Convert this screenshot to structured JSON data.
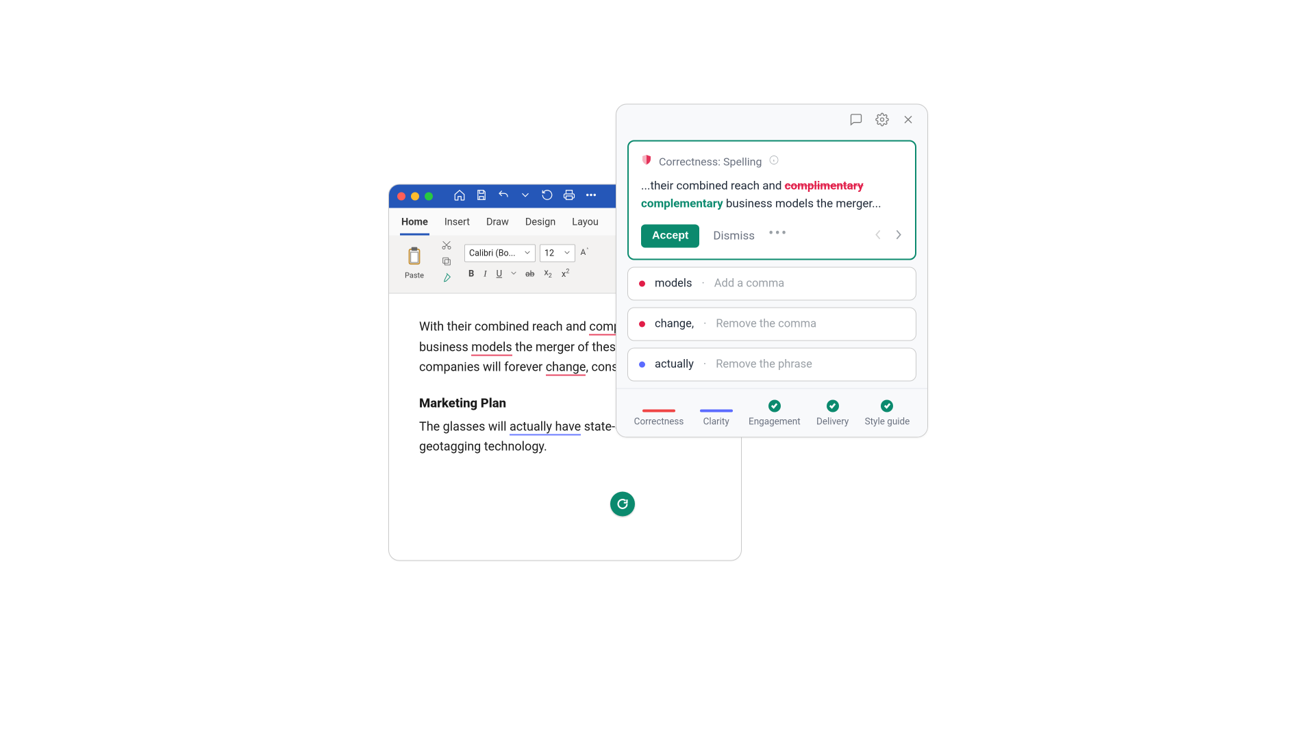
{
  "word": {
    "tabs": [
      "Home",
      "Insert",
      "Draw",
      "Design",
      "Layou"
    ],
    "activeTab": "Home",
    "paste_label": "Paste",
    "font_name": "Calibri (Bo...",
    "font_size": "12",
    "doc": {
      "p1_pre": "With their combined reach and ",
      "p1_err1": "complimentary",
      "p1_mid1": " business ",
      "p1_err2": "models",
      "p1_mid2": " the merger of these two great companies will forever ",
      "p1_err3": "change",
      "p1_post": ", consumer eyewear.",
      "h2": "Marketing Plan",
      "p2_pre": "The glasses will ",
      "p2_err": "actually have",
      "p2_post": " state-of-the-art geotagging technology."
    }
  },
  "panel": {
    "title": "Correctness: Spelling",
    "body_pre": "...their combined reach and ",
    "body_wrong": "complimentary",
    "body_fix": "complementary",
    "body_post": " business models the merger...",
    "accept": "Accept",
    "dismiss": "Dismiss",
    "items": [
      {
        "color": "red",
        "word": "models",
        "hint": "Add a comma"
      },
      {
        "color": "red",
        "word": "change,",
        "hint": "Remove the comma"
      },
      {
        "color": "blue",
        "word": "actually",
        "hint": "Remove the phrase"
      }
    ],
    "footer": [
      "Correctness",
      "Clarity",
      "Engagement",
      "Delivery",
      "Style guide"
    ]
  }
}
